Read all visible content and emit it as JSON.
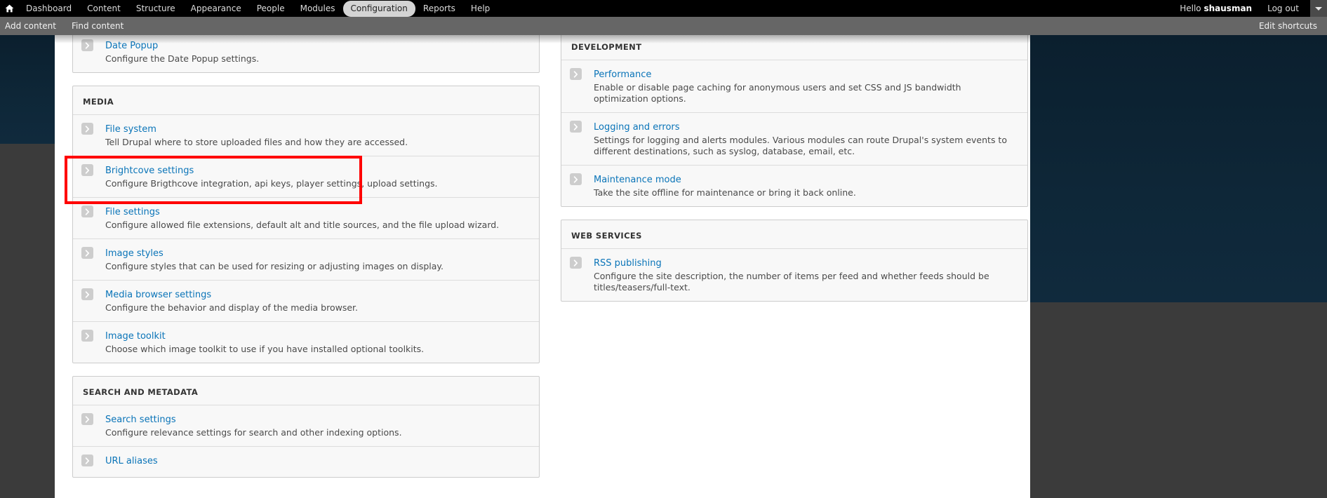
{
  "toolbar": {
    "home_icon": "home-icon",
    "items": [
      {
        "label": "Dashboard",
        "active": false
      },
      {
        "label": "Content",
        "active": false
      },
      {
        "label": "Structure",
        "active": false
      },
      {
        "label": "Appearance",
        "active": false
      },
      {
        "label": "People",
        "active": false
      },
      {
        "label": "Modules",
        "active": false
      },
      {
        "label": "Configuration",
        "active": true
      },
      {
        "label": "Reports",
        "active": false
      },
      {
        "label": "Help",
        "active": false
      }
    ],
    "greeting_prefix": "Hello",
    "username": "shausman",
    "logout_label": "Log out",
    "collapse_icon": "caret-down-icon"
  },
  "shortcuts": {
    "items": [
      {
        "label": "Add content"
      },
      {
        "label": "Find content"
      }
    ],
    "edit_label": "Edit shortcuts"
  },
  "colors": {
    "toolbar_bg": "#000000",
    "shortcut_bg": "#666666",
    "link": "#0a74b8",
    "panel_bg": "#f8f8f8",
    "panel_border": "#cccccc",
    "highlight": "#ff0000",
    "page_gutter": "#3b3b3b",
    "page_gutter_blue": "#0e2738"
  },
  "left_column": [
    {
      "id": "date-time-partial",
      "title": null,
      "headless": true,
      "rows": [
        {
          "link": "Date Popup",
          "desc": "Configure the Date Popup settings.",
          "highlighted": false
        }
      ]
    },
    {
      "id": "media",
      "title": "MEDIA",
      "headless": false,
      "rows": [
        {
          "link": "File system",
          "desc": "Tell Drupal where to store uploaded files and how they are accessed.",
          "highlighted": false
        },
        {
          "link": "Brightcove settings",
          "desc": "Configure Brigthcove integration, api keys, player settings, upload settings.",
          "highlighted": true
        },
        {
          "link": "File settings",
          "desc": "Configure allowed file extensions, default alt and title sources, and the file upload wizard.",
          "highlighted": false
        },
        {
          "link": "Image styles",
          "desc": "Configure styles that can be used for resizing or adjusting images on display.",
          "highlighted": false
        },
        {
          "link": "Media browser settings",
          "desc": "Configure the behavior and display of the media browser.",
          "highlighted": false
        },
        {
          "link": "Image toolkit",
          "desc": "Choose which image toolkit to use if you have installed optional toolkits.",
          "highlighted": false
        }
      ]
    },
    {
      "id": "search-and-metadata",
      "title": "SEARCH AND METADATA",
      "headless": false,
      "rows": [
        {
          "link": "Search settings",
          "desc": "Configure relevance settings for search and other indexing options.",
          "highlighted": false
        },
        {
          "link": "URL aliases",
          "desc": "",
          "highlighted": false
        }
      ]
    }
  ],
  "right_column": [
    {
      "id": "development",
      "title": "DEVELOPMENT",
      "headless": false,
      "rows": [
        {
          "link": "Performance",
          "desc": "Enable or disable page caching for anonymous users and set CSS and JS bandwidth optimization options.",
          "highlighted": false
        },
        {
          "link": "Logging and errors",
          "desc": "Settings for logging and alerts modules. Various modules can route Drupal's system events to different destinations, such as syslog, database, email, etc.",
          "highlighted": false
        },
        {
          "link": "Maintenance mode",
          "desc": "Take the site offline for maintenance or bring it back online.",
          "highlighted": false
        }
      ]
    },
    {
      "id": "web-services",
      "title": "WEB SERVICES",
      "headless": false,
      "rows": [
        {
          "link": "RSS publishing",
          "desc": "Configure the site description, the number of items per feed and whether feeds should be titles/teasers/full-text.",
          "highlighted": false
        }
      ]
    }
  ]
}
